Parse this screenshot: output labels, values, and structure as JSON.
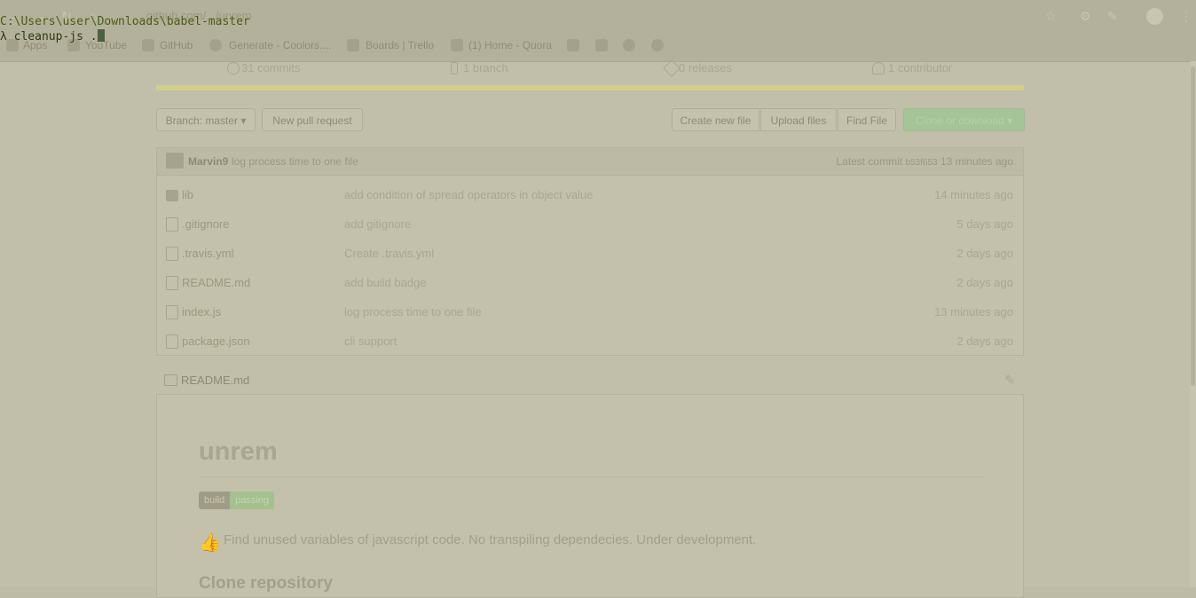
{
  "browser": {
    "url_text": "github.com/.../unrem",
    "bookmarks": [
      {
        "label": "Apps",
        "icon": "apps-icon"
      },
      {
        "label": "YouTube",
        "icon": "youtube-icon"
      },
      {
        "label": "GitHub",
        "icon": "github-icon"
      },
      {
        "label": "Generate - Coolors....",
        "icon": "coolors-icon"
      },
      {
        "label": "Boards | Trello",
        "icon": "trello-icon"
      },
      {
        "label": "(1) Home - Quora",
        "icon": "quora-icon"
      }
    ]
  },
  "repo": {
    "stats": {
      "commits": "31 commits",
      "branches": "1 branch",
      "releases": "0 releases",
      "contributors": "1 contributor"
    },
    "toolbar": {
      "branch": "Branch: master",
      "new_pr": "New pull request",
      "create_file": "Create new file",
      "upload": "Upload files",
      "find": "Find File",
      "clone": "Clone or download"
    },
    "latest_commit": {
      "author": "Marvin9",
      "message": "log process time to one file",
      "label": "Latest commit",
      "hash": "b53f653",
      "age": "13 minutes ago"
    },
    "files": [
      {
        "name": "lib",
        "type": "dir",
        "message": "add condition of spread operators in object value",
        "age": "14 minutes ago"
      },
      {
        "name": ".gitignore",
        "type": "file",
        "message": "add gitignore",
        "age": "5 days ago"
      },
      {
        "name": ".travis.yml",
        "type": "file",
        "message": "Create .travis.yml",
        "age": "2 days ago"
      },
      {
        "name": "README.md",
        "type": "file",
        "message": "add build badge",
        "age": "2 days ago"
      },
      {
        "name": "index.js",
        "type": "file",
        "message": "log process time to one file",
        "age": "13 minutes ago"
      },
      {
        "name": "package.json",
        "type": "file",
        "message": "cli support",
        "age": "2 days ago"
      }
    ],
    "readme": {
      "filename": "README.md",
      "heading": "unrem",
      "badge_left": "build",
      "badge_right": "passing",
      "description": "Find unused variables of javascript code. No transpiling dependecies. Under development.",
      "subheading": "Clone repository"
    }
  },
  "console": {
    "path_line": "C:\\Users\\user\\Downloads\\babel-master",
    "command_line": "λ cleanup-js ."
  },
  "colors": {
    "console_path": "#4c5e10",
    "console_cmd": "#2e3b12",
    "clone_button": "#a5c497"
  }
}
